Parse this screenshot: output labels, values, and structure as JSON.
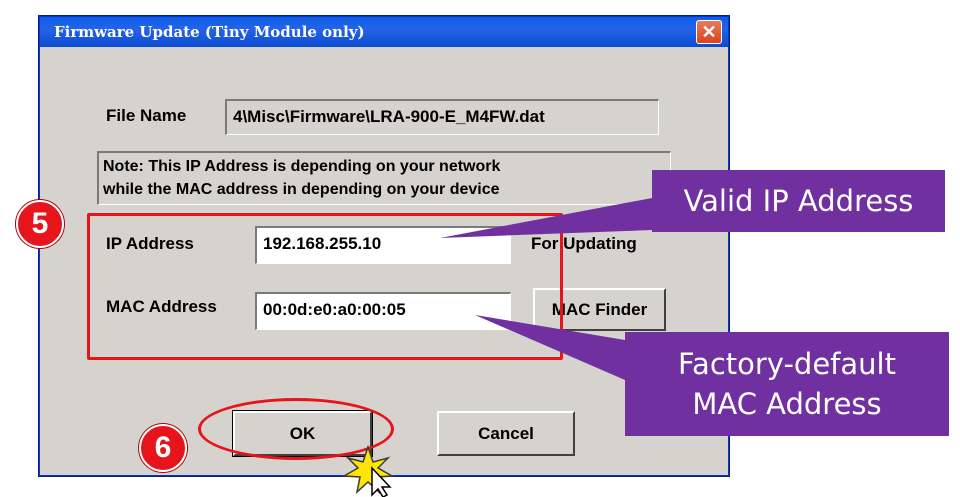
{
  "window": {
    "title": "Firmware Update (Tiny Module only)",
    "close_glyph": "✕"
  },
  "form": {
    "file_name_label": "File Name",
    "file_name_value": "4\\Misc\\Firmware\\LRA-900-E_M4FW.dat",
    "note_line1": "Note: This IP Address is depending on your network",
    "note_line2": "while the  MAC address in depending on your device",
    "ip_label": "IP Address",
    "ip_value": "192.168.255.10",
    "for_updating_label": "For Updating",
    "mac_label": "MAC Address",
    "mac_value": "00:0d:e0:a0:00:05",
    "mac_finder_label": "MAC Finder"
  },
  "buttons": {
    "ok_label": "OK",
    "cancel_label": "Cancel"
  },
  "annotations": {
    "step5": "5",
    "step6": "6",
    "callout_ip": "Valid IP Address",
    "callout_mac_line1": "Factory-default",
    "callout_mac_line2": "MAC Address"
  },
  "colors": {
    "titlebar": "#0a5fe6",
    "dialog_face": "#d6d3ce",
    "highlight_red": "#e8141b",
    "callout_purple": "#7030a0"
  }
}
